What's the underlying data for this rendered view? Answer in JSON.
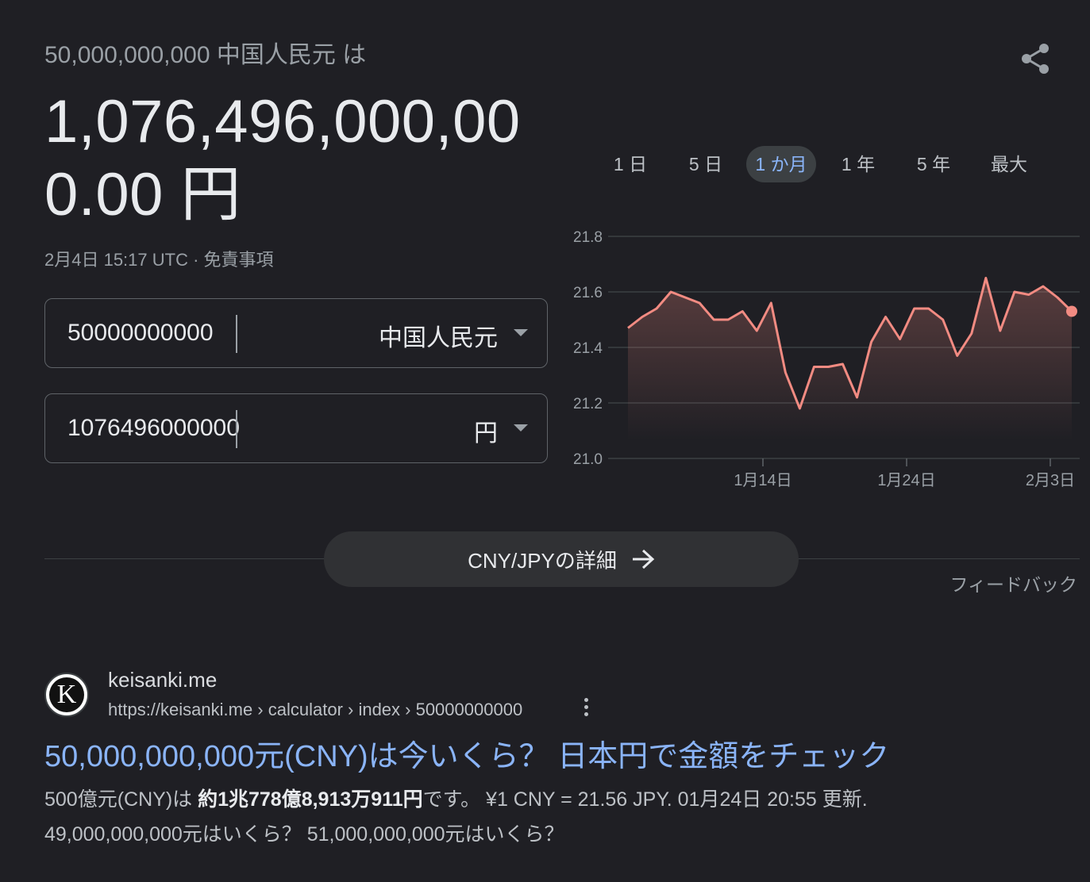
{
  "header": {
    "query": "50,000,000,000 中国人民元 は",
    "result": "1,076,496,000,000.00 円",
    "timestamp": "2月4日 15:17 UTC · 免責事項"
  },
  "converter": {
    "from_value": "50000000000",
    "from_currency": "中国人民元",
    "to_value": "1076496000000",
    "to_currency": "円"
  },
  "ranges": [
    "1 日",
    "5 日",
    "1 か月",
    "1 年",
    "5 年",
    "最大"
  ],
  "active_range": "1 か月",
  "colors": {
    "line": "#f28b82",
    "accent": "#8ab4f8",
    "background": "#1f1f24"
  },
  "chart_data": {
    "type": "area",
    "y_ticks": [
      "21.8",
      "21.6",
      "21.4",
      "21.2",
      "21.0"
    ],
    "x_ticks": [
      "1月14日",
      "1月24日",
      "2月3日"
    ],
    "ylim": [
      21.0,
      21.8
    ],
    "grid": true,
    "values": [
      21.47,
      21.51,
      21.54,
      21.6,
      21.58,
      21.56,
      21.5,
      21.5,
      21.53,
      21.46,
      21.56,
      21.31,
      21.18,
      21.33,
      21.33,
      21.34,
      21.22,
      21.42,
      21.51,
      21.43,
      21.54,
      21.54,
      21.5,
      21.37,
      21.45,
      21.65,
      21.46,
      21.6,
      21.59,
      21.62,
      21.58,
      21.53
    ]
  },
  "details_button": "CNY/JPYの詳細",
  "feedback": "フィードバック",
  "search_result": {
    "favicon_letter": "K",
    "site_name": "keisanki.me",
    "breadcrumb": "https://keisanki.me › calculator › index › 50000000000",
    "title": "50,000,000,000元(CNY)は今いくら？ 日本円で金額をチェック",
    "snippet_1_prefix": "500億元(CNY)は ",
    "snippet_1_bold": "約1兆778億8,913万911円",
    "snippet_1_suffix": "です。 ¥1 CNY = 21.56 JPY. 01月24日 20:55 更新.",
    "snippet_2": "49,000,000,000元はいくら？ 51,000,000,000元はいくら？"
  }
}
